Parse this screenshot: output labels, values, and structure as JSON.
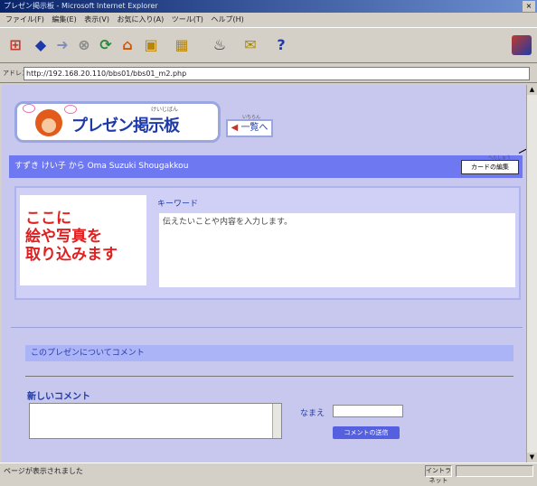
{
  "window": {
    "title": "プレゼン掲示板 - Microsoft Internet Explorer",
    "close_glyph": "×",
    "menu": [
      "ファイル(F)",
      "編集(E)",
      "表示(V)",
      "お気に入り(A)",
      "ツール(T)",
      "ヘルプ(H)"
    ],
    "toolbar": [
      {
        "icon": "windows-logo-icon",
        "glyph": "⊞",
        "color": "#c0392b"
      },
      {
        "icon": "back-arrow-icon",
        "glyph": "◆",
        "color": "#1e3aa8"
      },
      {
        "icon": "forward-arrow-icon",
        "glyph": "➜",
        "color": "#7f8fb8"
      },
      {
        "icon": "stop-icon",
        "glyph": "⊗",
        "color": "#888888"
      },
      {
        "icon": "refresh-icon",
        "glyph": "⟳",
        "color": "#2a8a3a"
      },
      {
        "icon": "home-icon",
        "glyph": "⌂",
        "color": "#d35400"
      },
      {
        "icon": "search-icon",
        "glyph": "▣",
        "color": "#b8860b"
      },
      {
        "icon": "favorites-icon",
        "glyph": "▦",
        "color": "#b8860b"
      },
      {
        "icon": "history-icon",
        "glyph": "♨",
        "color": "#333333"
      },
      {
        "icon": "mail-icon",
        "glyph": "✉",
        "color": "#aa8800"
      },
      {
        "icon": "help-icon",
        "glyph": "?",
        "color": "#1e3aa8"
      }
    ],
    "address_label": "アドレス",
    "address_url": "http://192.168.20.110/bbs01/bbs01_m2.php",
    "status_text": "ページが表示されました",
    "status_zone": "イントラネット"
  },
  "page": {
    "logo_title": "プレゼン掲示板",
    "logo_ruby": "けいじばん",
    "back_button": "一覧へ",
    "back_button_ruby": "いちらん",
    "author_line": "すずき けい子 から Oma Suzuki Shougakkou",
    "card_button": "カードの編集",
    "card_button_ruby": "へんしゅう",
    "photo_placeholder": [
      "ここに",
      "絵や写真を",
      "取り込みます"
    ],
    "keyword_label": "キーワード",
    "keyword_text": "伝えたいことや内容を入力します。",
    "comment_header": "このプレゼンについてコメント",
    "my_comment_label": "新しいコメント",
    "name_label": "なまえ",
    "name_value": "",
    "submit_button": "コメントの送信"
  },
  "colors": {
    "page_bg": "#c8c8ee",
    "namebar": "#6e78f0",
    "accent": "#1e3aa8",
    "photo_text": "#e02020"
  }
}
